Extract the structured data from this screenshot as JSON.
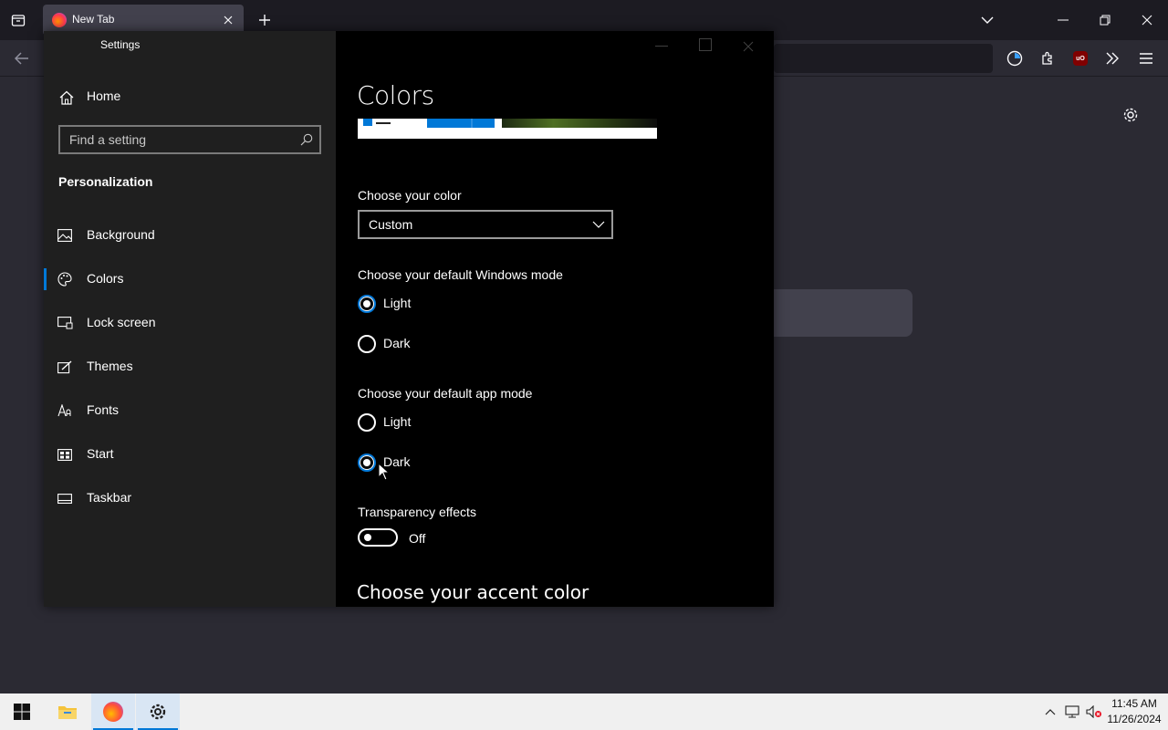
{
  "browser": {
    "tab_title": "New Tab"
  },
  "settings": {
    "window_title": "Settings",
    "home_label": "Home",
    "search_placeholder": "Find a setting",
    "section": "Personalization",
    "nav": [
      {
        "label": "Background",
        "icon": "picture-icon"
      },
      {
        "label": "Colors",
        "icon": "palette-icon",
        "selected": true
      },
      {
        "label": "Lock screen",
        "icon": "lock-screen-icon"
      },
      {
        "label": "Themes",
        "icon": "themes-icon"
      },
      {
        "label": "Fonts",
        "icon": "fonts-icon"
      },
      {
        "label": "Start",
        "icon": "start-icon"
      },
      {
        "label": "Taskbar",
        "icon": "taskbar-icon"
      }
    ]
  },
  "content": {
    "title": "Colors",
    "choose_color_label": "Choose your color",
    "choose_color_value": "Custom",
    "windows_mode_label": "Choose your default Windows mode",
    "windows_mode_options": [
      "Light",
      "Dark"
    ],
    "windows_mode_selected": "Light",
    "app_mode_label": "Choose your default app mode",
    "app_mode_options": [
      "Light",
      "Dark"
    ],
    "app_mode_selected": "Dark",
    "transparency_label": "Transparency effects",
    "transparency_state": "Off",
    "accent_heading": "Choose your accent color"
  },
  "taskbar": {
    "time": "11:45 AM",
    "date": "11/26/2024"
  },
  "colors": {
    "accent": "#0078d7",
    "sidebar_bg": "#1f1f1f",
    "content_bg": "#000000",
    "browser_bg": "#2b2a33"
  }
}
